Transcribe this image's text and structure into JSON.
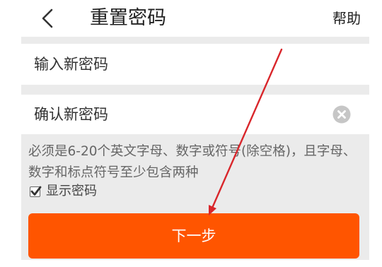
{
  "header": {
    "title": "重置密码",
    "help_label": "帮助",
    "back_icon": "chevron-left-icon"
  },
  "form": {
    "new_password": {
      "placeholder": "输入新密码"
    },
    "confirm_password": {
      "placeholder": "确认新密码",
      "clear_icon": "clear-circle-icon"
    }
  },
  "hint": "必须是6-20个英文字母、数字或符号(除空格)，且字母、数字和标点符号至少包含两种",
  "show_password": {
    "label": "显示密码",
    "checked": true,
    "check_icon": "checkmark-icon"
  },
  "next_button": {
    "label": "下一步"
  },
  "colors": {
    "accent": "#ff5500",
    "annotation": "#d9262b",
    "panel_background": "#ebebeb",
    "clear_icon": "#c6c6c6"
  }
}
